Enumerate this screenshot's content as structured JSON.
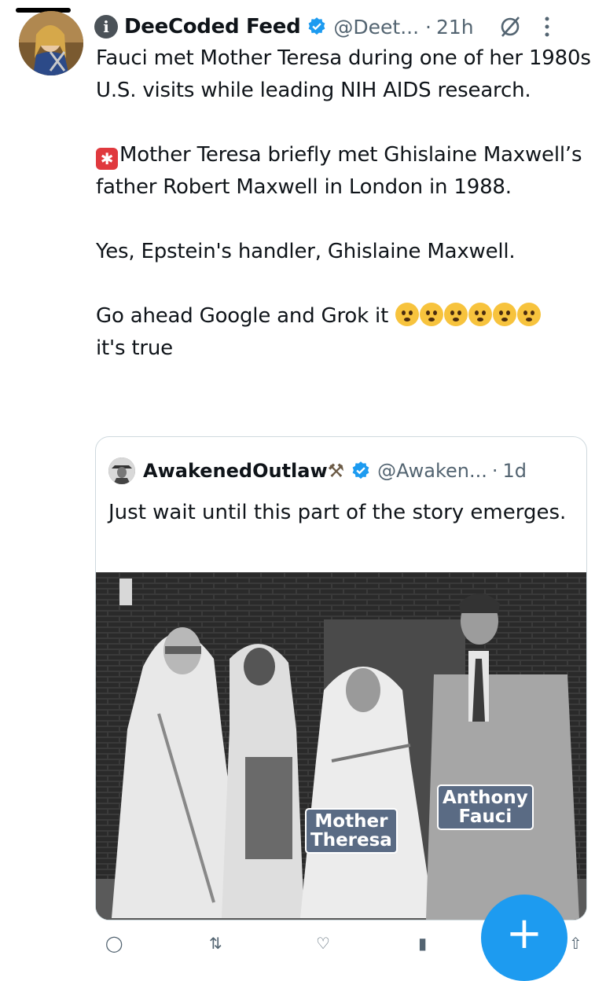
{
  "tweet": {
    "info_icon": "i",
    "display_name": "DeeCoded Feed",
    "handle": "@Deet...",
    "separator": "·",
    "time": "21h",
    "paragraphs": [
      "Fauci met Mother Teresa during one of her 1980s U.S. visits while leading NIH AIDS research.",
      "Mother Teresa briefly met Ghislaine Maxwell’s father Robert Maxwell in London in 1988.",
      "Yes, Epstein's handler, Ghislaine Maxwell.",
      "Go ahead Google and Grok it",
      "it's true"
    ],
    "siren_icon": "police-car-light-icon",
    "emoji_icons": [
      "pleading-face",
      "relieved-face",
      "hushed-face",
      "hushed-face",
      "flushed-face",
      "flushed-face"
    ]
  },
  "quote": {
    "display_name": "AwakenedOutlaw",
    "hammer_emoji": "⚒",
    "handle": "@Awaken...",
    "separator": "·",
    "time": "1d",
    "text": "Just wait until this part of the story emerges.",
    "image_labels": {
      "mother_theresa": [
        "Mother",
        "Theresa"
      ],
      "anthony_fauci": [
        "Anthony",
        "Fauci"
      ]
    }
  },
  "fab": {
    "label": "+"
  },
  "colors": {
    "accent": "#1d9bf0",
    "secondary_text": "#536471",
    "verified": "#1d9bf0",
    "label_box": "#5a6b84"
  }
}
